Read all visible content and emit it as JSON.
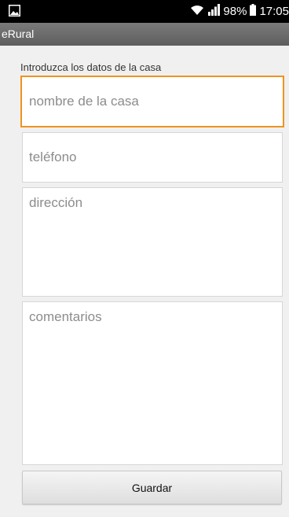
{
  "status_bar": {
    "battery": "98%",
    "time": "17:05",
    "icons": [
      "screenshot-icon",
      "wifi-icon",
      "signal-icon",
      "battery-icon"
    ]
  },
  "app_bar": {
    "title": "eRural"
  },
  "form": {
    "label": "Introduzca los datos de la casa",
    "name_placeholder": "nombre de la casa",
    "name_value": "",
    "phone_placeholder": "teléfono",
    "phone_value": "",
    "address_placeholder": "dirección",
    "address_value": "",
    "comments_placeholder": "comentarios",
    "comments_value": "",
    "save_label": "Guardar"
  },
  "colors": {
    "focus_border": "#f0931e",
    "status_bar": "#000000",
    "app_bar": "#6b6b6b"
  }
}
